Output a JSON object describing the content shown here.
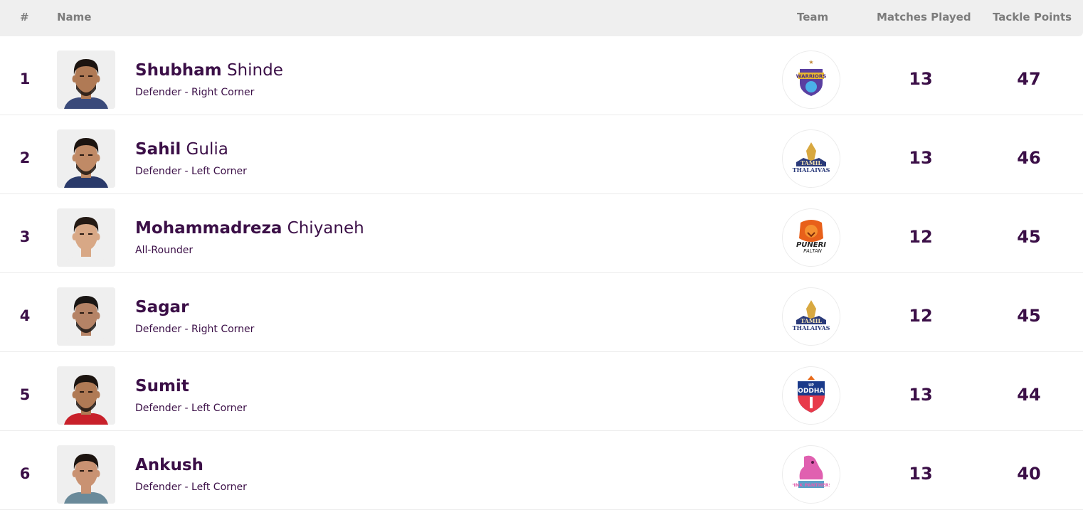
{
  "header": {
    "rank": "#",
    "name": "Name",
    "team": "Team",
    "matches_played": "Matches Played",
    "tackle_points": "Tackle Points"
  },
  "rows": [
    {
      "rank": "1",
      "first": "Shubham",
      "last": " Shinde",
      "role": "Defender - Right Corner",
      "team": "Bengal Warriors",
      "team_icon": "bengal-warriors-logo",
      "matches": "13",
      "points": "47",
      "shirt": "#3a4a7a",
      "skin": "#b07a55",
      "hair": "#1c1410",
      "beard": true
    },
    {
      "rank": "2",
      "first": "Sahil",
      "last": " Gulia",
      "role": "Defender - Left Corner",
      "team": "Tamil Thalaivas",
      "team_icon": "tamil-thalaivas-logo",
      "matches": "13",
      "points": "46",
      "shirt": "#2a3a6a",
      "skin": "#c08a66",
      "hair": "#1c1410",
      "beard": true
    },
    {
      "rank": "3",
      "first": "Mohammadreza",
      "last": " Chiyaneh",
      "role": "All-Rounder",
      "team": "Puneri Paltan",
      "team_icon": "puneri-paltan-logo",
      "matches": "12",
      "points": "45",
      "shirt": "#efefef",
      "skin": "#d8a886",
      "hair": "#241a14",
      "beard": false
    },
    {
      "rank": "4",
      "first": "Sagar",
      "last": "",
      "role": "Defender - Right Corner",
      "team": "Tamil Thalaivas",
      "team_icon": "tamil-thalaivas-logo",
      "matches": "12",
      "points": "45",
      "shirt": "#efefef",
      "skin": "#b58366",
      "hair": "#1a1614",
      "beard": true
    },
    {
      "rank": "5",
      "first": "Sumit",
      "last": "",
      "role": "Defender - Left Corner",
      "team": "UP Yoddhas",
      "team_icon": "up-yoddhas-logo",
      "matches": "13",
      "points": "44",
      "shirt": "#c8202a",
      "skin": "#b07a55",
      "hair": "#1c1410",
      "beard": true
    },
    {
      "rank": "6",
      "first": "Ankush",
      "last": "",
      "role": "Defender - Left Corner",
      "team": "Jaipur Pink Panthers",
      "team_icon": "jaipur-pink-panthers-logo",
      "matches": "13",
      "points": "40",
      "shirt": "#6a8a9a",
      "skin": "#c99272",
      "hair": "#1c1410",
      "beard": false
    }
  ]
}
